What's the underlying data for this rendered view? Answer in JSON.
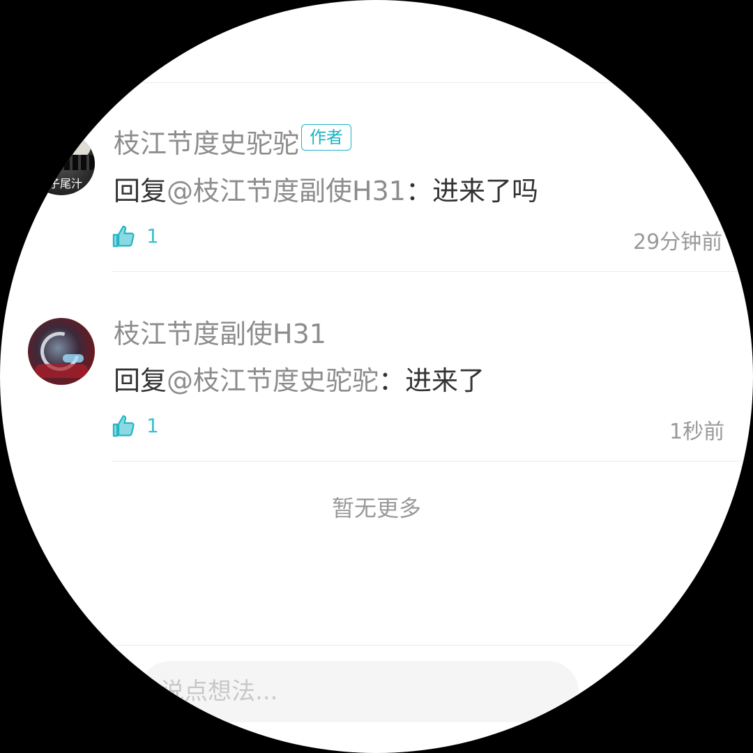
{
  "comments": [
    {
      "author": "枝江节度史驼驼",
      "badge": "作者",
      "avatar_caption": "子尾汁",
      "reply_prefix": "回复",
      "mention": "@枝江节度副使H31",
      "separator": "：",
      "text": "进来了吗",
      "likes": "1",
      "time": "29分钟前"
    },
    {
      "author": "枝江节度副使H31",
      "reply_prefix": "回复",
      "mention": "@枝江节度史驼驼",
      "separator": "：",
      "text": "进来了",
      "likes": "1",
      "time": "1秒前"
    }
  ],
  "footer": {
    "no_more": "暂无更多"
  },
  "input": {
    "placeholder": "说点想法..."
  },
  "colors": {
    "accent": "#1bb3c4",
    "like": "#39c1cf",
    "name": "#8c8c8c",
    "text": "#333333"
  },
  "icons": {
    "like": "thumbs-up-icon"
  }
}
